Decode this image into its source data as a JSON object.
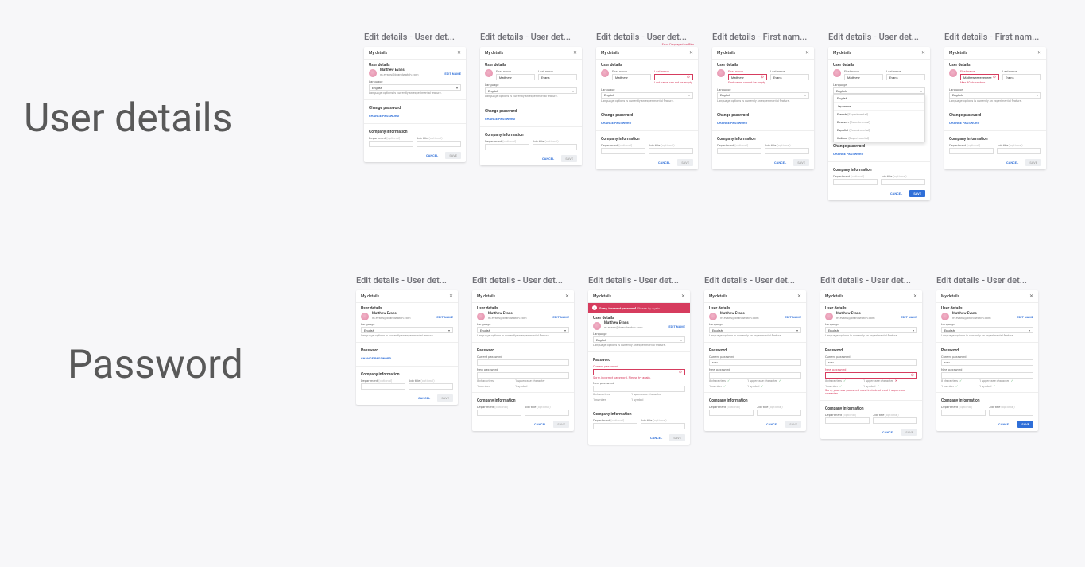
{
  "section_labels": {
    "user_details": "User details",
    "password": "Password"
  },
  "common": {
    "panel_title": "My details",
    "close": "✕",
    "user_details_title": "User details",
    "change_pw_title": "Change password",
    "company_info_title": "Company information",
    "edit_name": "EDIT NAME",
    "language_label": "Language",
    "lang_helper": "Language options is currently an experimental feature.",
    "change_pw_link": "CHANGE PASSWORD",
    "dept_label": "Department",
    "dept_opt": "(optional)",
    "job_label": "Job title",
    "job_opt": "(optional)",
    "cancel": "CANCEL",
    "save": "SAVE",
    "caret": "▾",
    "first_name_label": "First name",
    "last_name_label": "Last name",
    "user": {
      "name": "Matthew Evans",
      "email": "m.evans@brandwatch.com",
      "first": "Matthew",
      "last": "Evans"
    },
    "languages": {
      "english": "English",
      "japanese": "Japanese",
      "french": "French",
      "german": "Deutsch",
      "spanish": "Español",
      "italian": "Italiano",
      "exp": "(Experimental)"
    },
    "pw": {
      "section_title": "Password",
      "current": "Current password",
      "new": "New password",
      "c8": "8 characters",
      "c_upper": "1 uppercase character",
      "c_num": "1 number",
      "c_sym": "1 symbol",
      "dots": "•••••"
    }
  },
  "row1": [
    {
      "title": "Edit details - User det...",
      "mode": "view"
    },
    {
      "title": "Edit details - User det...",
      "mode": "editName"
    },
    {
      "title": "Edit details - User det...",
      "mode": "editNameErrorLast",
      "annotation": "Error Displayed on Blur",
      "last_error": "Last name can not be empty"
    },
    {
      "title": "Edit details - First nam...",
      "mode": "editNameErrorFirst",
      "first_error": "First name cannot be empty"
    },
    {
      "title": "Edit details - User det...",
      "mode": "langOpen"
    },
    {
      "title": "Edit details - First nam...",
      "mode": "editNameMaxChar",
      "first_val": "Matheweeeeeeeeee",
      "max_error": "Max 40 characters"
    }
  ],
  "row2": [
    {
      "title": "Edit details - User det...",
      "mode": "pwCollapsed"
    },
    {
      "title": "Edit details - User det...",
      "mode": "pwExpandedEmpty"
    },
    {
      "title": "Edit details - User det...",
      "mode": "pwIncorrect",
      "banner": "Sorry, incorrect password.",
      "banner_thin": "Please try again.",
      "cur_err": "Sorry, incorrect password. Please try again."
    },
    {
      "title": "Edit details - User det...",
      "mode": "pwValid"
    },
    {
      "title": "Edit details - User det...",
      "mode": "pwNeedsUpper",
      "new_err": "Sorry, your new password must include at least 1 uppercase character"
    },
    {
      "title": "Edit details - User det...",
      "mode": "pwAllGood"
    }
  ]
}
